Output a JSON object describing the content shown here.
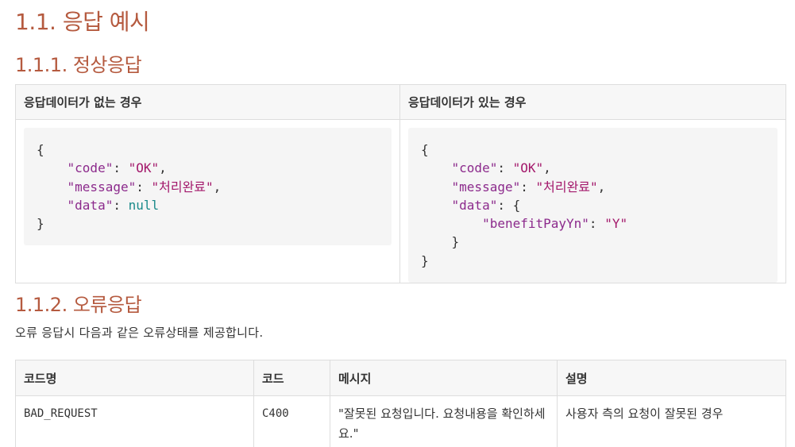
{
  "headings": {
    "section": "1.1. 응답 예시",
    "normal": "1.1.1. 정상응답",
    "error": "1.1.2. 오류응답"
  },
  "examples_table": {
    "headers": [
      "응답데이터가 없는 경우",
      "응답데이터가 있는 경우"
    ],
    "no_data": {
      "open": "{",
      "code_key": "\"code\"",
      "code_val": "\"OK\"",
      "message_key": "\"message\"",
      "message_val": "\"처리완료\"",
      "data_key": "\"data\"",
      "data_val": "null",
      "close": "}"
    },
    "with_data": {
      "open": "{",
      "code_key": "\"code\"",
      "code_val": "\"OK\"",
      "message_key": "\"message\"",
      "message_val": "\"처리완료\"",
      "data_key": "\"data\"",
      "data_open": "{",
      "inner_key": "\"benefitPayYn\"",
      "inner_val": "\"Y\"",
      "inner_close": "}",
      "close": "}"
    }
  },
  "error_description": "오류 응답시 다음과 같은 오류상태를 제공합니다.",
  "errors_table": {
    "headers": [
      "코드명",
      "코드",
      "메시지",
      "설명"
    ],
    "rows": [
      {
        "name": "BAD_REQUEST",
        "code": "C400",
        "message": "\"잘못된 요청입니다. 요청내용을 확인하세요.\"",
        "description": "사용자 측의 요청이 잘못된 경우"
      }
    ]
  },
  "colors": {
    "heading": "#b55a3f",
    "json_key": "#8c2a8c",
    "json_string": "#a3186b",
    "json_null": "#1a8a8a",
    "code_background": "#f5f5f5",
    "table_header_background": "#f7f7f7",
    "border": "#dddddd"
  }
}
